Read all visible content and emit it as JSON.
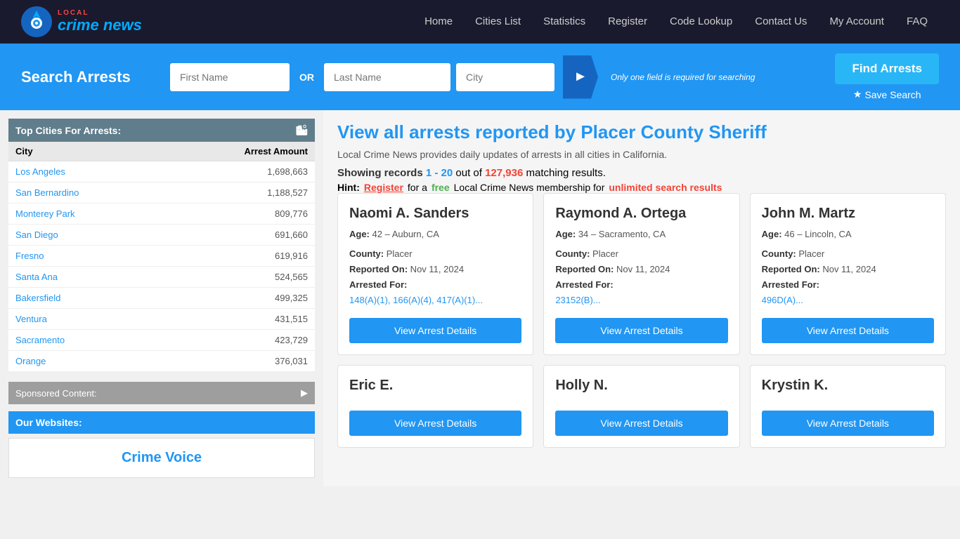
{
  "nav": {
    "links": [
      {
        "label": "Home",
        "id": "home"
      },
      {
        "label": "Cities List",
        "id": "cities-list"
      },
      {
        "label": "Statistics",
        "id": "statistics"
      },
      {
        "label": "Register",
        "id": "register"
      },
      {
        "label": "Code Lookup",
        "id": "code-lookup"
      },
      {
        "label": "Contact Us",
        "id": "contact-us"
      },
      {
        "label": "My Account",
        "id": "my-account"
      },
      {
        "label": "FAQ",
        "id": "faq"
      }
    ]
  },
  "search": {
    "label": "Search Arrests",
    "first_name_placeholder": "First Name",
    "last_name_placeholder": "Last Name",
    "city_placeholder": "City",
    "or_label": "OR",
    "hint": "Only one field is required for searching",
    "find_btn": "Find Arrests",
    "save_link": "Save Search"
  },
  "sidebar": {
    "top_cities_title": "Top Cities For Arrests:",
    "columns": {
      "city": "City",
      "arrest_amount": "Arrest Amount"
    },
    "cities": [
      {
        "name": "Los Angeles",
        "count": "1,698,663"
      },
      {
        "name": "San Bernardino",
        "count": "1,188,527"
      },
      {
        "name": "Monterey Park",
        "count": "809,776"
      },
      {
        "name": "San Diego",
        "count": "691,660"
      },
      {
        "name": "Fresno",
        "count": "619,916"
      },
      {
        "name": "Santa Ana",
        "count": "524,565"
      },
      {
        "name": "Bakersfield",
        "count": "499,325"
      },
      {
        "name": "Ventura",
        "count": "431,515"
      },
      {
        "name": "Sacramento",
        "count": "423,729"
      },
      {
        "name": "Orange",
        "count": "376,031"
      }
    ],
    "sponsored_title": "Sponsored Content:",
    "our_websites_title": "Our Websites:",
    "crime_voice_label": "Crime Voice"
  },
  "main": {
    "heading": "View all arrests reported by Placer County Sheriff",
    "subtext": "Local Crime News provides daily updates of arrests in all cities in California.",
    "showing_label": "Showing records",
    "range": "1 - 20",
    "out_of": "out of",
    "total": "127,936",
    "matching": "matching results.",
    "hint_prefix": "Hint:",
    "register_text": "Register",
    "hint_middle": "for a",
    "free_text": "free",
    "hint_suffix": "Local Crime News membership for",
    "unlimited_text": "unlimited search results"
  },
  "cards_row1": [
    {
      "name": "Naomi A. Sanders",
      "age": "42",
      "location": "Auburn, CA",
      "county": "Placer",
      "reported_on": "Nov 11, 2024",
      "arrested_for": "148(A)(1), 166(A)(4), 417(A)(1)...",
      "btn": "View Arrest Details"
    },
    {
      "name": "Raymond A. Ortega",
      "age": "34",
      "location": "Sacramento, CA",
      "county": "Placer",
      "reported_on": "Nov 11, 2024",
      "arrested_for": "23152(B)...",
      "btn": "View Arrest Details"
    },
    {
      "name": "John M. Martz",
      "age": "46",
      "location": "Lincoln, CA",
      "county": "Placer",
      "reported_on": "Nov 11, 2024",
      "arrested_for": "496D(A)...",
      "btn": "View Arrest Details"
    }
  ],
  "cards_row2": [
    {
      "name": "Eric E.",
      "age": "",
      "location": "",
      "county": "",
      "reported_on": "",
      "arrested_for": "",
      "btn": "View Arrest Details"
    },
    {
      "name": "Holly N.",
      "age": "",
      "location": "",
      "county": "",
      "reported_on": "",
      "arrested_for": "",
      "btn": "View Arrest Details"
    },
    {
      "name": "Krystin K.",
      "age": "",
      "location": "",
      "county": "",
      "reported_on": "",
      "arrested_for": "",
      "btn": "View Arrest Details"
    }
  ]
}
